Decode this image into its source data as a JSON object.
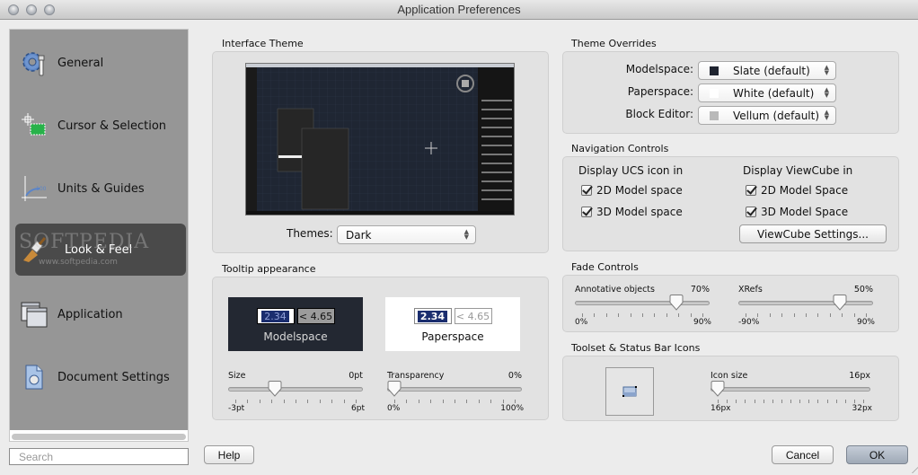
{
  "window": {
    "title": "Application Preferences"
  },
  "sidebar": {
    "items": [
      {
        "label": "General",
        "icon": "gear-wrench-icon",
        "active": false
      },
      {
        "label": "Cursor & Selection",
        "icon": "crosshair-selection-icon",
        "active": false
      },
      {
        "label": "Units & Guides",
        "icon": "units-graph-icon",
        "active": false
      },
      {
        "label": "Look & Feel",
        "icon": "paintbrush-icon",
        "active": true
      },
      {
        "label": "Application",
        "icon": "windows-icon",
        "active": false
      },
      {
        "label": "Document Settings",
        "icon": "document-icon",
        "active": false
      }
    ],
    "watermark": "SOFTPEDIA",
    "watermark_url": "www.softpedia.com",
    "search_placeholder": "Search"
  },
  "interface_theme": {
    "label": "Interface Theme",
    "themes_label": "Themes:",
    "theme_value": "Dark"
  },
  "tooltip": {
    "label": "Tooltip appearance",
    "modelspace": {
      "name": "Modelspace",
      "value1": "2.34",
      "value2": "< 4.65"
    },
    "paperspace": {
      "name": "Paperspace",
      "value1": "2.34",
      "value2": "< 4.65"
    },
    "size": {
      "name": "Size",
      "value": "0pt",
      "min": "-3pt",
      "max": "6pt",
      "fraction": 0.33
    },
    "transparency": {
      "name": "Transparency",
      "value": "0%",
      "min": "0%",
      "max": "100%",
      "fraction": 0.0
    }
  },
  "theme_overrides": {
    "label": "Theme Overrides",
    "rows": [
      {
        "label": "Modelspace:",
        "value": "Slate (default)",
        "swatch": "#1f2430"
      },
      {
        "label": "Paperspace:",
        "value": "White (default)",
        "swatch": "#ffffff"
      },
      {
        "label": "Block Editor:",
        "value": "Vellum (default)",
        "swatch": "#b9b9b9"
      }
    ]
  },
  "navigation": {
    "label": "Navigation Controls",
    "ucs_heading": "Display UCS icon in",
    "ucs": [
      {
        "label": "2D Model space",
        "checked": true
      },
      {
        "label": "3D Model space",
        "checked": true
      }
    ],
    "viewcube_heading": "Display ViewCube in",
    "viewcube": [
      {
        "label": "2D Model Space",
        "checked": true
      },
      {
        "label": "3D Model Space",
        "checked": true
      }
    ],
    "viewcube_settings": "ViewCube Settings..."
  },
  "fade": {
    "label": "Fade Controls",
    "annotative": {
      "name": "Annotative objects",
      "value": "70%",
      "min": "0%",
      "max": "90%",
      "fraction": 0.78
    },
    "xrefs": {
      "name": "XRefs",
      "value": "50%",
      "min": "-90%",
      "max": "90%",
      "fraction": 0.78
    }
  },
  "toolset": {
    "label": "Toolset & Status Bar Icons",
    "icon_size": {
      "name": "Icon size",
      "value": "16px",
      "min": "16px",
      "max": "32px",
      "fraction": 0.0
    }
  },
  "buttons": {
    "help": "Help",
    "cancel": "Cancel",
    "ok": "OK"
  }
}
